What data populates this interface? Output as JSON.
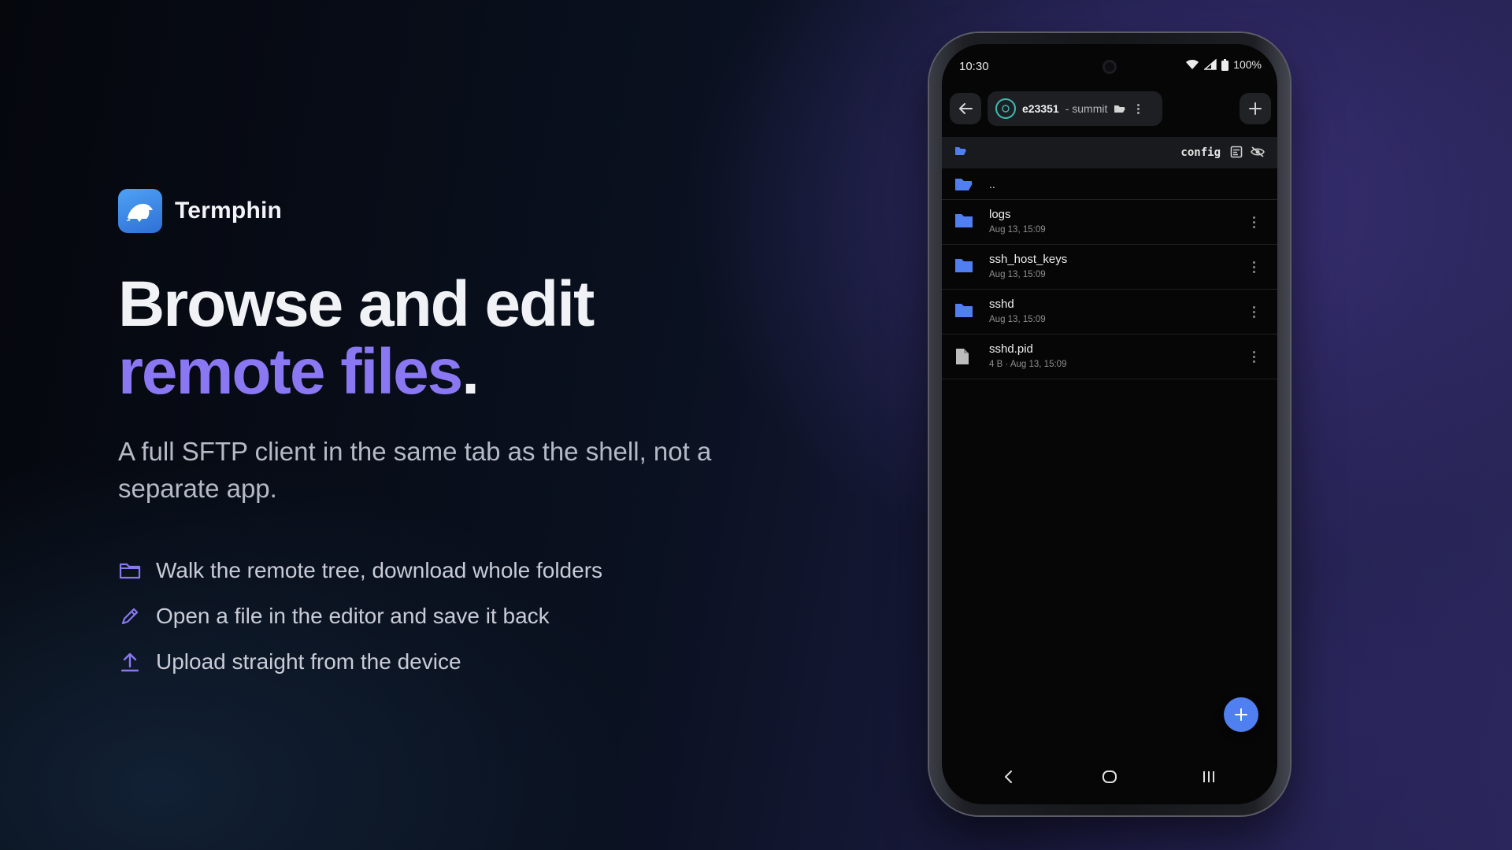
{
  "brand": {
    "name": "Termphin"
  },
  "headline": {
    "line1": "Browse and edit",
    "line2_accent": "remote files",
    "line2_end": "."
  },
  "subtitle": "A full SFTP client in the same tab as the shell, not a separate app.",
  "features": [
    {
      "icon": "folder-icon",
      "text": "Walk the remote tree, download whole folders"
    },
    {
      "icon": "pencil-icon",
      "text": "Open a file in the editor and save it back"
    },
    {
      "icon": "upload-icon",
      "text": "Upload straight from the device"
    }
  ],
  "phone": {
    "status": {
      "time": "10:30",
      "battery": "100%"
    },
    "session": {
      "host": "e23351",
      "label": "- summit"
    },
    "path": {
      "current": "config"
    },
    "files": {
      "parent": "..",
      "items": [
        {
          "name": "logs",
          "meta": "Aug 13, 15:09",
          "kind": "folder"
        },
        {
          "name": "ssh_host_keys",
          "meta": "Aug 13, 15:09",
          "kind": "folder"
        },
        {
          "name": "sshd",
          "meta": "Aug 13, 15:09",
          "kind": "folder"
        },
        {
          "name": "sshd.pid",
          "meta": "4 B · Aug 13, 15:09",
          "kind": "file"
        }
      ]
    }
  },
  "colors": {
    "accent": "#8a77f2",
    "folder": "#4f7ff0",
    "fab": "#4f7ff0",
    "chip_ring": "#3fbab0"
  }
}
